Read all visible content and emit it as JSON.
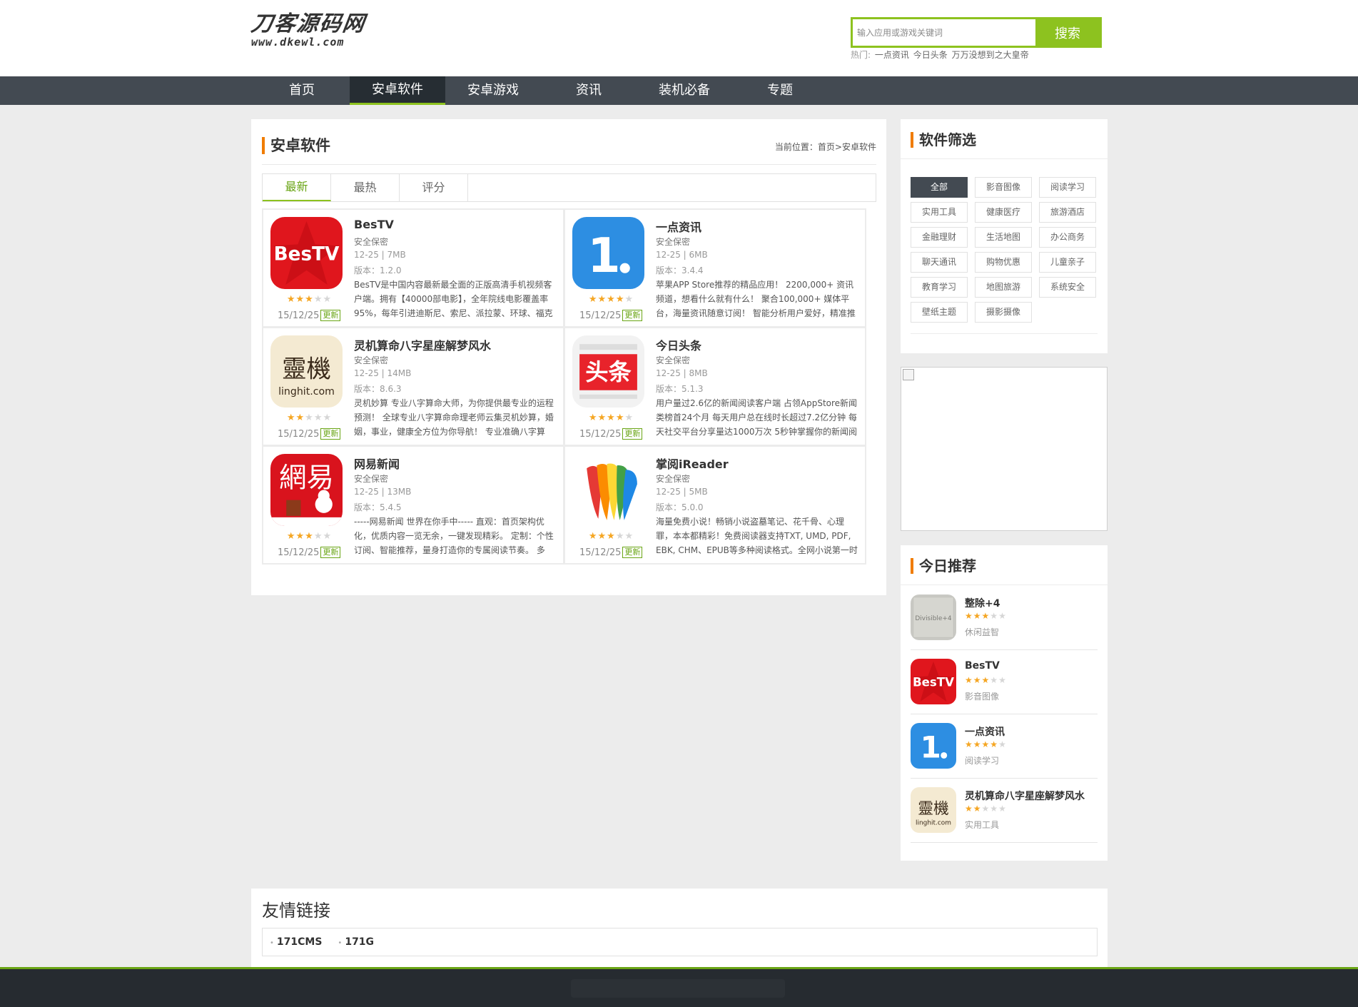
{
  "site": {
    "logo_cn": "刀客源码网",
    "logo_en": "www.dkewl.com"
  },
  "search": {
    "placeholder": "输入应用或游戏关键词",
    "button": "搜索",
    "hot_label": "热门:",
    "hot_links": [
      "一点资讯",
      "今日头条",
      "万万没想到之大皇帝"
    ]
  },
  "nav": {
    "items": [
      "首页",
      "安卓软件",
      "安卓游戏",
      "资讯",
      "装机必备",
      "专题"
    ],
    "active": "安卓软件"
  },
  "main": {
    "title": "安卓软件",
    "breadcrumb_label": "当前位置：",
    "breadcrumb_home": "首页",
    "breadcrumb_sep": ">",
    "breadcrumb_current": "安卓软件",
    "tabs": [
      "最新",
      "最热",
      "评分"
    ],
    "active_tab": "最新",
    "update_badge": "更新",
    "apps": [
      {
        "name": "BesTV",
        "safe": "安全保密",
        "size": "12-25 | 7MB",
        "version": "版本：1.2.0",
        "desc": "BesTV是中国内容最新最全面的正版高清手机视频客户端。拥有【40000部电影】，全年院线电影覆盖率95%，每年引进迪斯尼、索尼、派拉蒙、环球、福克",
        "rating": 3,
        "date": "15/12/25",
        "icon": "bestv-logo"
      },
      {
        "name": "一点资讯",
        "safe": "安全保密",
        "size": "12-25 | 6MB",
        "version": "版本：3.4.4",
        "desc": "苹果APP Store推荐的精品应用！ 2200,000+ 资讯频道，想看什么就有什么！ 聚合100,000+ 媒体平台，海量资讯随意订阅！ 智能分析用户爱好，精准推荐你",
        "rating": 4,
        "date": "15/12/25",
        "icon": "yidian-logo"
      },
      {
        "name": "灵机算命八字星座解梦风水",
        "safe": "安全保密",
        "size": "12-25 | 14MB",
        "version": "版本：8.6.3",
        "desc": "灵机妙算 专业八字算命大师，为你提供最专业的运程预测！ 全球专业八字算命命理老师云集灵机妙算，婚姻，事业，健康全方位为你导航！ 专业准确八字算",
        "rating": 2,
        "date": "15/12/25",
        "icon": "linghit-logo"
      },
      {
        "name": "今日头条",
        "safe": "安全保密",
        "size": "12-25 | 8MB",
        "version": "版本：5.1.3",
        "desc": "用户量过2.6亿的新闻阅读客户端 占领AppStore新闻类榜首24个月 每天用户总在线时长超过7.2亿分钟 每天社交平台分享量达1000万次 5秒钟掌握你的新闻阅",
        "rating": 4,
        "date": "15/12/25",
        "icon": "toutiao-logo"
      },
      {
        "name": "网易新闻",
        "safe": "安全保密",
        "size": "12-25 | 13MB",
        "version": "版本：5.4.5",
        "desc": "-----网易新闻 世界在你手中----- 直观：首页架构优化，优质内容一览无余，一键发现精彩。 定制：个性订阅、智能推荐，量身打造你的专属阅读节奏。 多",
        "rating": 3,
        "date": "15/12/25",
        "icon": "netease-logo"
      },
      {
        "name": "掌阅iReader",
        "safe": "安全保密",
        "size": "12-25 | 5MB",
        "version": "版本：5.0.0",
        "desc": "海量免费小说！畅销小说盗墓笔记、花千骨、心理罪，本本都精彩！免费阅读器支持TXT, UMD, PDF, EBK, CHM、EPUB等多种阅读格式。全网小说第一时",
        "rating": 3,
        "date": "15/12/25",
        "icon": "ireader-logo"
      }
    ]
  },
  "filter": {
    "title": "软件筛选",
    "items": [
      "全部",
      "影音图像",
      "阅读学习",
      "实用工具",
      "健康医疗",
      "旅游酒店",
      "金融理财",
      "生活地图",
      "办公商务",
      "聊天通讯",
      "购物优惠",
      "儿童亲子",
      "教育学习",
      "地图旅游",
      "系统安全",
      "壁纸主题",
      "摄影摄像"
    ],
    "active": "全部"
  },
  "recommend": {
    "title": "今日推荐",
    "items": [
      {
        "name": "整除+4",
        "rating": 3,
        "category": "休闲益智",
        "icon": "divisible-logo",
        "icon_text": "Divisible+4"
      },
      {
        "name": "BesTV",
        "rating": 3,
        "category": "影音图像",
        "icon": "bestv-logo"
      },
      {
        "name": "一点资讯",
        "rating": 4,
        "category": "阅读学习",
        "icon": "yidian-logo"
      },
      {
        "name": "灵机算命八字星座解梦风水",
        "rating": 2,
        "category": "实用工具",
        "icon": "linghit-logo"
      }
    ]
  },
  "links": {
    "title": "友情链接",
    "items": [
      "171CMS",
      "171G"
    ]
  },
  "colors": {
    "accent_green": "#8dc21f",
    "nav_bg": "#434a52",
    "title_bar_orange": "#f07c00",
    "star": "#f5a623"
  }
}
